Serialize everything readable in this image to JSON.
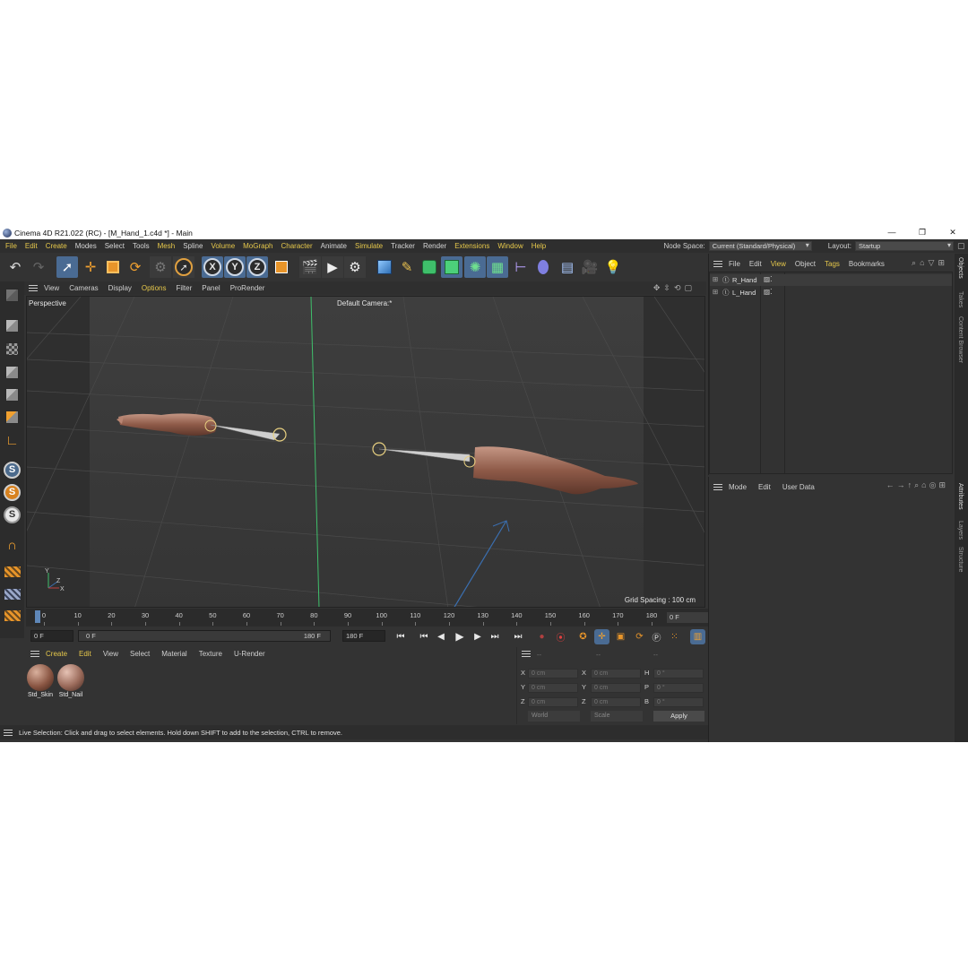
{
  "window": {
    "title": "Cinema 4D R21.022 (RC) - [M_Hand_1.c4d *] - Main",
    "controls": [
      "—",
      "❐",
      "✕"
    ]
  },
  "menubar": {
    "items": [
      {
        "label": "File",
        "hl": true
      },
      {
        "label": "Edit",
        "hl": true
      },
      {
        "label": "Create",
        "hl": true
      },
      {
        "label": "Modes",
        "hl": false
      },
      {
        "label": "Select",
        "hl": false
      },
      {
        "label": "Tools",
        "hl": false
      },
      {
        "label": "Mesh",
        "hl": true
      },
      {
        "label": "Spline",
        "hl": false
      },
      {
        "label": "Volume",
        "hl": true
      },
      {
        "label": "MoGraph",
        "hl": true
      },
      {
        "label": "Character",
        "hl": true
      },
      {
        "label": "Animate",
        "hl": false
      },
      {
        "label": "Simulate",
        "hl": true
      },
      {
        "label": "Tracker",
        "hl": false
      },
      {
        "label": "Render",
        "hl": false
      },
      {
        "label": "Extensions",
        "hl": true
      },
      {
        "label": "Window",
        "hl": true
      },
      {
        "label": "Help",
        "hl": true
      }
    ],
    "node_space_label": "Node Space:",
    "node_space_value": "Current (Standard/Physical)",
    "layout_label": "Layout:",
    "layout_value": "Startup"
  },
  "toolbar": {
    "axis_x": "X",
    "axis_y": "Y",
    "axis_z": "Z",
    "icons": [
      "undo-icon",
      "redo-icon",
      "live-selection-icon",
      "move-icon",
      "scale-icon",
      "rotate-icon",
      "recent-tools-icon",
      "select-tool-icon",
      "x-axis-lock",
      "y-axis-lock",
      "z-axis-lock",
      "coordinate-system-icon",
      "render-view-icon",
      "render-picture-viewer-icon",
      "render-settings-icon",
      "cube-icon",
      "pen-icon",
      "subdivision-icon",
      "extrude-icon",
      "cloner-icon",
      "mograph-icon",
      "deformer-icon",
      "field-icon",
      "floor-icon",
      "camera-icon",
      "light-icon"
    ]
  },
  "left_tools": {
    "s_labels": [
      "S",
      "S",
      "S"
    ]
  },
  "viewport_menu": {
    "items": [
      {
        "label": "View",
        "hl": false
      },
      {
        "label": "Cameras",
        "hl": false
      },
      {
        "label": "Display",
        "hl": false
      },
      {
        "label": "Options",
        "hl": true
      },
      {
        "label": "Filter",
        "hl": false
      },
      {
        "label": "Panel",
        "hl": false
      },
      {
        "label": "ProRender",
        "hl": false
      }
    ]
  },
  "viewport": {
    "view_name": "Perspective",
    "camera": "Default Camera",
    "camera_suffix": ":*",
    "grid_spacing": "Grid Spacing : 100 cm",
    "axis_labels": {
      "y": "Y",
      "z": "Z",
      "x": "X"
    }
  },
  "timeline": {
    "ticks": [
      "0",
      "10",
      "20",
      "30",
      "40",
      "50",
      "60",
      "70",
      "80",
      "90",
      "100",
      "110",
      "120",
      "130",
      "140",
      "150",
      "160",
      "170",
      "180"
    ],
    "current_frame_value": "0 F"
  },
  "transport": {
    "start_frame": "0 F",
    "range_start": "0 F",
    "range_end": "180 F",
    "end_frame": "180 F"
  },
  "material_manager": {
    "menu": [
      {
        "label": "Create",
        "hl": true
      },
      {
        "label": "Edit",
        "hl": true
      },
      {
        "label": "View",
        "hl": false
      },
      {
        "label": "Select",
        "hl": false
      },
      {
        "label": "Material",
        "hl": false
      },
      {
        "label": "Texture",
        "hl": false
      },
      {
        "label": "U-Render",
        "hl": false
      }
    ],
    "materials": [
      {
        "name": "Std_Skin"
      },
      {
        "name": "Std_Nail"
      }
    ]
  },
  "coordinates": {
    "header_dashes": [
      "--",
      "--",
      "--"
    ],
    "rows": [
      {
        "l1": "X",
        "v1": "0 cm",
        "l2": "X",
        "v2": "0 cm",
        "l3": "H",
        "v3": "0 °"
      },
      {
        "l1": "Y",
        "v1": "0 cm",
        "l2": "Y",
        "v2": "0 cm",
        "l3": "P",
        "v3": "0 °"
      },
      {
        "l1": "Z",
        "v1": "0 cm",
        "l2": "Z",
        "v2": "0 cm",
        "l3": "B",
        "v3": "0 °"
      }
    ],
    "space": "World",
    "mode": "Scale",
    "apply": "Apply"
  },
  "statusbar": {
    "text": "Live Selection: Click and drag to select elements. Hold down SHIFT to add to the selection, CTRL to remove."
  },
  "object_manager": {
    "menu": [
      {
        "label": "File",
        "hl": false
      },
      {
        "label": "Edit",
        "hl": false
      },
      {
        "label": "View",
        "hl": true
      },
      {
        "label": "Object",
        "hl": false
      },
      {
        "label": "Tags",
        "hl": true
      },
      {
        "label": "Bookmarks",
        "hl": false
      }
    ],
    "objects": [
      {
        "name": "R_Hand"
      },
      {
        "name": "L_Hand"
      }
    ]
  },
  "attribute_manager": {
    "menu": [
      "Mode",
      "Edit",
      "User Data"
    ]
  },
  "side_tabs": {
    "top": [
      "Objects",
      "Takes",
      "Content Browser"
    ],
    "bottom": [
      "Attributes",
      "Layers",
      "Structure"
    ]
  },
  "colors": {
    "accent_menu": "#e6c84b",
    "ui_background": "#333333",
    "selected_button": "#4a6b93",
    "playhead": "#5f87b8"
  }
}
